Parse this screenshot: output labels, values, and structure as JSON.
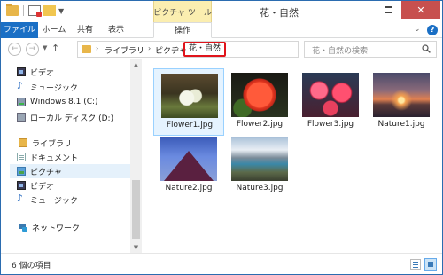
{
  "window": {
    "title": "花・自然",
    "context_tab_group": "ピクチャ ツール"
  },
  "ribbon": {
    "tabs": [
      {
        "label": "ファイル"
      },
      {
        "label": "ホーム"
      },
      {
        "label": "共有"
      },
      {
        "label": "表示"
      },
      {
        "label": "操作"
      }
    ],
    "help_label": "?"
  },
  "address": {
    "crumbs": [
      "ライブラリ",
      "ピクチャ"
    ],
    "current": "花・自然"
  },
  "search": {
    "placeholder": "花・自然の検索"
  },
  "nav_pane": {
    "items": [
      {
        "label": "ビデオ",
        "icon": "video-icon"
      },
      {
        "label": "ミュージック",
        "icon": "music-icon"
      },
      {
        "label": "Windows 8.1 (C:)",
        "icon": "drive-icon"
      },
      {
        "label": "ローカル ディスク (D:)",
        "icon": "drive-icon"
      },
      {
        "label": "ライブラリ",
        "icon": "libraries-icon"
      },
      {
        "label": "ドキュメント",
        "icon": "documents-icon"
      },
      {
        "label": "ピクチャ",
        "icon": "pictures-icon",
        "selected": true
      },
      {
        "label": "ビデオ",
        "icon": "video-icon"
      },
      {
        "label": "ミュージック",
        "icon": "music-icon"
      },
      {
        "label": "ネットワーク",
        "icon": "network-icon"
      }
    ]
  },
  "files": [
    {
      "name": "Flower1.jpg",
      "selected": true
    },
    {
      "name": "Flower2.jpg"
    },
    {
      "name": "Flower3.jpg"
    },
    {
      "name": "Nature1.jpg"
    },
    {
      "name": "Nature2.jpg"
    },
    {
      "name": "Nature3.jpg"
    }
  ],
  "status": {
    "count": "6 個の項目"
  },
  "colors": {
    "accent": "#1a6fc5",
    "context_tab": "#fbeeb0",
    "highlight_border": "#e0141b",
    "selection": "#e5f3ff"
  }
}
